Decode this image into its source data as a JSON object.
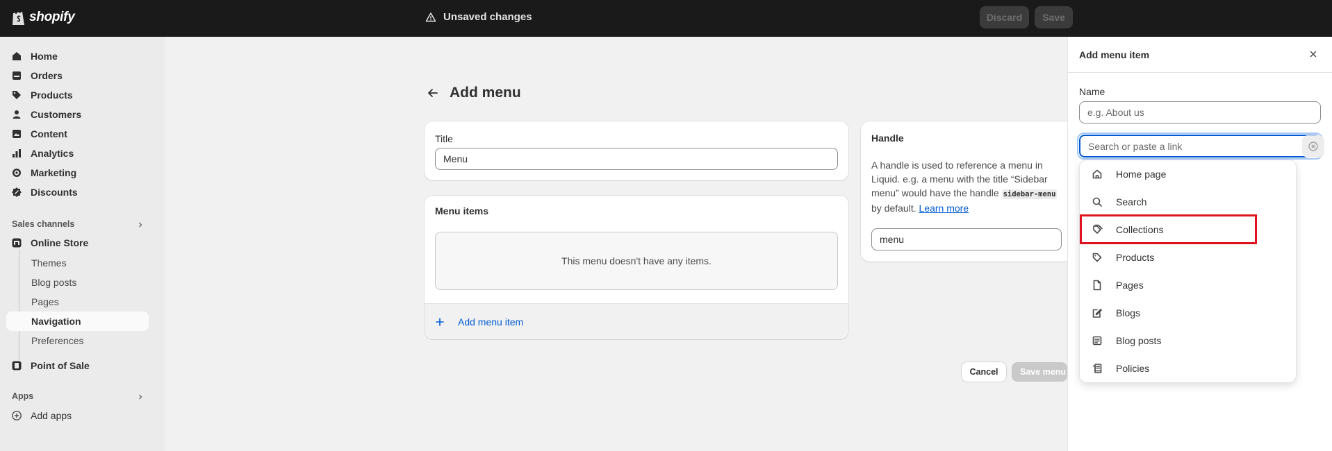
{
  "topbar": {
    "logo_text": "shopify",
    "unsaved_label": "Unsaved changes",
    "discard_label": "Discard",
    "save_label": "Save"
  },
  "sidebar": {
    "main_items": [
      {
        "label": "Home",
        "icon": "home-icon"
      },
      {
        "label": "Orders",
        "icon": "orders-icon"
      },
      {
        "label": "Products",
        "icon": "tag-icon"
      },
      {
        "label": "Customers",
        "icon": "person-icon"
      },
      {
        "label": "Content",
        "icon": "content-icon"
      },
      {
        "label": "Analytics",
        "icon": "analytics-icon"
      },
      {
        "label": "Marketing",
        "icon": "target-icon"
      },
      {
        "label": "Discounts",
        "icon": "discount-icon"
      }
    ],
    "sales_channels_label": "Sales channels",
    "online_store_label": "Online Store",
    "online_store_sub": [
      "Themes",
      "Blog posts",
      "Pages",
      "Navigation",
      "Preferences"
    ],
    "active_sub": "Navigation",
    "point_of_sale_label": "Point of Sale",
    "apps_label": "Apps",
    "add_apps_label": "Add apps"
  },
  "page": {
    "title": "Add menu",
    "title_card": {
      "label": "Title",
      "value": "Menu"
    },
    "menu_items_card": {
      "label": "Menu items",
      "empty_text": "This menu doesn't have any items.",
      "add_item_label": "Add menu item"
    },
    "handle_card": {
      "label": "Handle",
      "desc_1": "A handle is used to reference a menu in Liquid. e.g. a menu with the title “Sidebar menu” would have the handle",
      "code": "sidebar-menu",
      "desc_2": "by default.",
      "learn_more": "Learn more",
      "value": "menu"
    },
    "cancel_label": "Cancel",
    "save_menu_label": "Save menu"
  },
  "panel": {
    "title": "Add menu item",
    "name_label": "Name",
    "name_placeholder": "e.g. About us",
    "link_placeholder": "Search or paste a link",
    "options": [
      {
        "label": "Home page",
        "icon": "home-icon"
      },
      {
        "label": "Search",
        "icon": "search-icon"
      },
      {
        "label": "Collections",
        "icon": "collections-icon"
      },
      {
        "label": "Products",
        "icon": "tag-icon"
      },
      {
        "label": "Pages",
        "icon": "page-icon"
      },
      {
        "label": "Blogs",
        "icon": "blog-icon"
      },
      {
        "label": "Blog posts",
        "icon": "blog-post-icon"
      },
      {
        "label": "Policies",
        "icon": "policies-icon"
      }
    ],
    "highlighted_option": "Collections"
  },
  "colors": {
    "topbar": "#1a1a1a",
    "link": "#005bd3",
    "highlight": "#e0121d",
    "sidebar": "#ebebeb"
  }
}
